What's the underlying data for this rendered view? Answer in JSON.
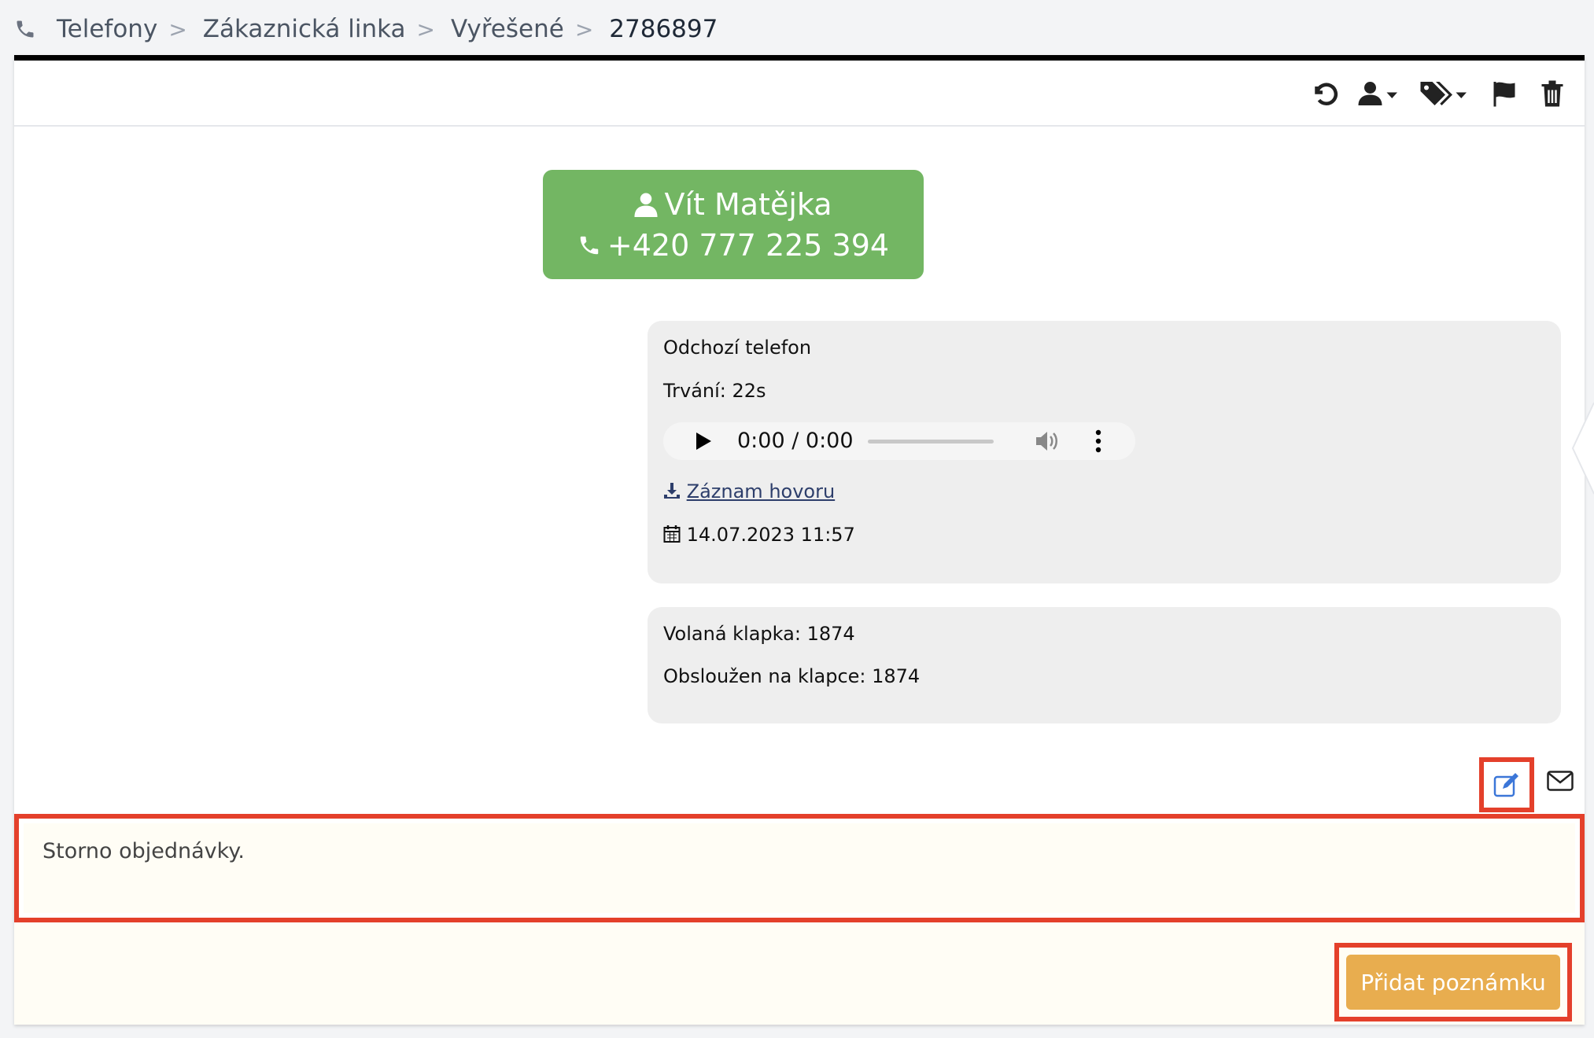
{
  "breadcrumb": {
    "items": [
      "Telefony",
      "Zákaznická linka",
      "Vyřešené"
    ],
    "separator": ">",
    "current": "2786897"
  },
  "toolbar": {
    "icons": [
      "undo-icon",
      "assign-user-icon",
      "tags-icon",
      "flag-icon",
      "trash-icon"
    ]
  },
  "contact": {
    "name": "Vít Matějka",
    "phone": "+420 777 225 394"
  },
  "call": {
    "type": "Odchozí telefon",
    "duration": "Trvání: 22s",
    "player_time": "0:00 / 0:00",
    "recording_link": "Záznam hovoru",
    "datetime": "14.07.2023 11:57"
  },
  "extension": {
    "called": "Volaná klapka: 1874",
    "served": "Obsloužen na klapce: 1874"
  },
  "note": {
    "value": "Storno objednávky."
  },
  "add_note_button": "Přidat poznámku",
  "colors": {
    "contact_bg": "#73b663",
    "button_bg": "#e8ad4f",
    "highlight": "#e4402b",
    "note_bg": "#fffdf5"
  }
}
